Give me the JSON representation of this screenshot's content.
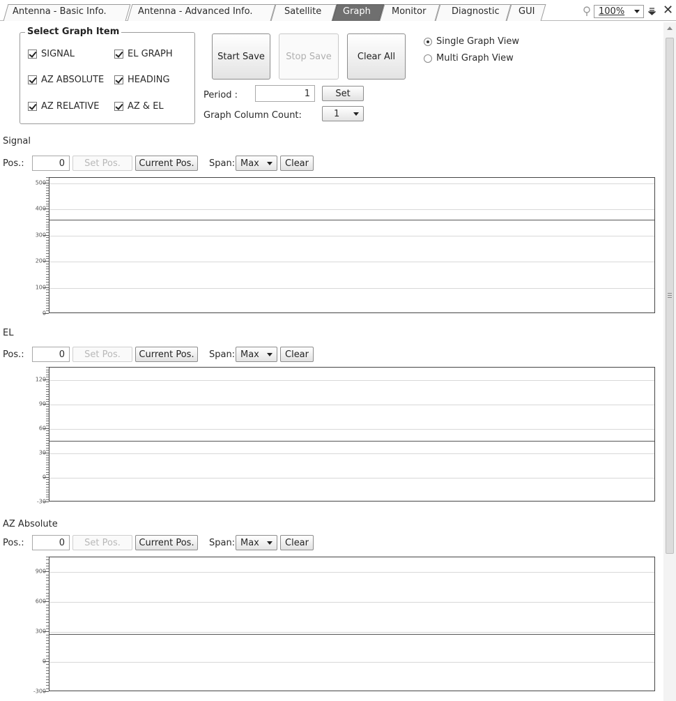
{
  "tabs": [
    {
      "label": "Antenna - Basic Info.",
      "active": false
    },
    {
      "label": "Antenna - Advanced Info.",
      "active": false
    },
    {
      "label": "Satellite",
      "active": false
    },
    {
      "label": "Graph",
      "active": true
    },
    {
      "label": "Monitor",
      "active": false
    },
    {
      "label": "Diagnostic",
      "active": false
    },
    {
      "label": "GUI",
      "active": false
    }
  ],
  "zoom": {
    "value": "100%"
  },
  "select_group": {
    "title": "Select Graph Item",
    "items": [
      {
        "label": "SIGNAL",
        "checked": true
      },
      {
        "label": "EL GRAPH",
        "checked": true
      },
      {
        "label": "AZ ABSOLUTE",
        "checked": true
      },
      {
        "label": "HEADING",
        "checked": true
      },
      {
        "label": "AZ RELATIVE",
        "checked": true
      },
      {
        "label": "AZ & EL",
        "checked": true
      }
    ]
  },
  "buttons": {
    "start_save": "Start Save",
    "stop_save": "Stop Save",
    "clear_all": "Clear All",
    "set": "Set"
  },
  "view_mode": {
    "single": "Single Graph View",
    "multi": "Multi Graph View",
    "selected": "single"
  },
  "period": {
    "label": "Period :",
    "value": "1"
  },
  "column_count": {
    "label": "Graph Column Count:",
    "value": "1"
  },
  "graphs": [
    {
      "title": "Signal",
      "controls": {
        "pos_label": "Pos.:",
        "pos_value": "0",
        "set_pos": "Set Pos.",
        "current_pos": "Current Pos.",
        "span_label": "Span:",
        "span_value": "Max",
        "clear": "Clear"
      },
      "chart_data": {
        "type": "line",
        "ylim": [
          0,
          520
        ],
        "yticks": [
          0,
          100,
          200,
          300,
          400,
          500
        ],
        "series": [
          {
            "values": [
              360,
              360
            ]
          }
        ],
        "grid": true
      }
    },
    {
      "title": "EL",
      "controls": {
        "pos_label": "Pos.:",
        "pos_value": "0",
        "set_pos": "Set Pos.",
        "current_pos": "Current Pos.",
        "span_label": "Span:",
        "span_value": "Max",
        "clear": "Clear"
      },
      "chart_data": {
        "type": "line",
        "ylim": [
          -30,
          135
        ],
        "yticks": [
          -30,
          0,
          30,
          60,
          90,
          120
        ],
        "series": [
          {
            "values": [
              45,
              45
            ]
          }
        ],
        "grid": true
      }
    },
    {
      "title": "AZ Absolute",
      "controls": {
        "pos_label": "Pos.:",
        "pos_value": "0",
        "set_pos": "Set Pos.",
        "current_pos": "Current Pos.",
        "span_label": "Span:",
        "span_value": "Max",
        "clear": "Clear"
      },
      "chart_data": {
        "type": "line",
        "ylim": [
          -300,
          1050
        ],
        "yticks": [
          -300,
          0,
          300,
          600,
          900
        ],
        "series": [
          {
            "values": [
              280,
              280
            ]
          }
        ],
        "grid": true
      }
    }
  ]
}
